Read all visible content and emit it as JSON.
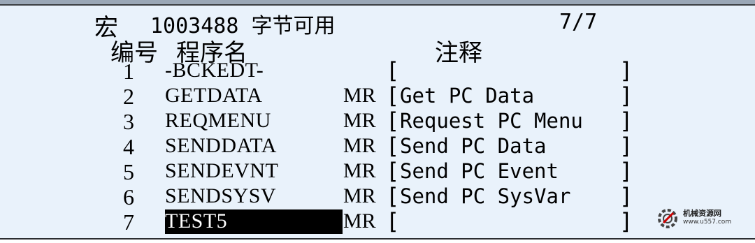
{
  "status": {
    "label": "宏",
    "bytes_free": "1003488 字节可用",
    "page": "7/7"
  },
  "headers": {
    "number": "编号",
    "program_name": "程序名",
    "comment": "注释"
  },
  "programs": [
    {
      "num": "1",
      "name": "-BCKEDT-",
      "type": "",
      "comment": ""
    },
    {
      "num": "2",
      "name": "GETDATA",
      "type": "MR",
      "comment": "Get PC Data"
    },
    {
      "num": "3",
      "name": "REQMENU",
      "type": "MR",
      "comment": "Request PC Menu"
    },
    {
      "num": "4",
      "name": "SENDDATA",
      "type": "MR",
      "comment": "Send PC Data"
    },
    {
      "num": "5",
      "name": "SENDEVNT",
      "type": "MR",
      "comment": "Send PC Event"
    },
    {
      "num": "6",
      "name": "SENDSYSV",
      "type": "MR",
      "comment": "Send PC SysVar"
    },
    {
      "num": "7",
      "name": "TEST5",
      "type": "MR",
      "comment": ""
    }
  ],
  "brackets": {
    "left": "[",
    "right": "]"
  },
  "selected_index": 6,
  "watermark": {
    "name": "机械资源网",
    "url": "www.u557.com",
    "icon": "gear-icon"
  }
}
